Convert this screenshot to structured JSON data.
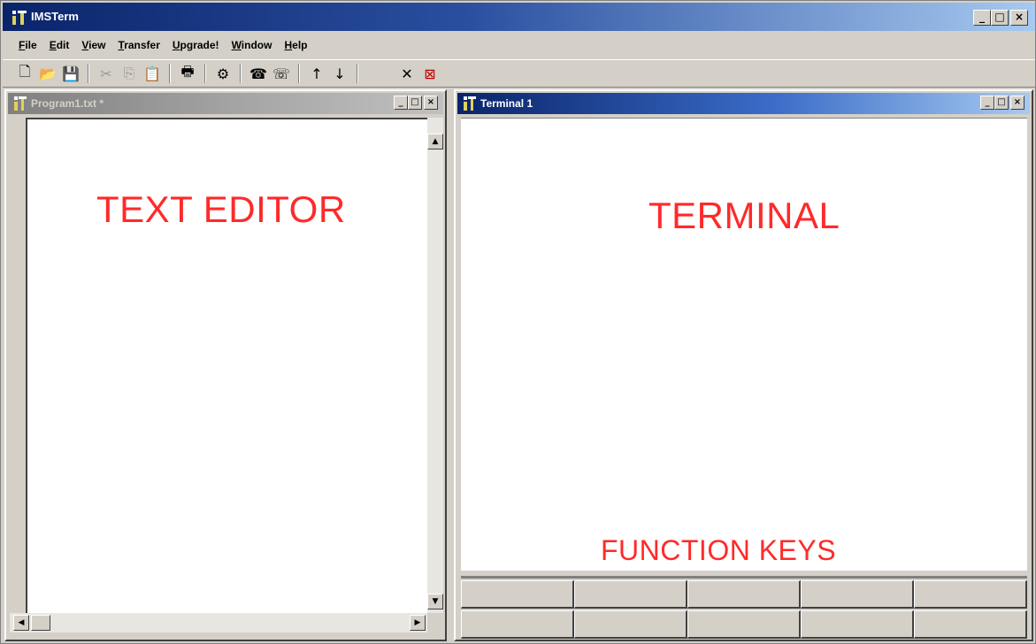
{
  "app": {
    "title": "IMSTerm",
    "window_buttons": [
      "_",
      "□",
      "×"
    ]
  },
  "menu": [
    {
      "accel": "F",
      "rest": "ile"
    },
    {
      "accel": "E",
      "rest": "dit"
    },
    {
      "accel": "V",
      "rest": "iew"
    },
    {
      "accel": "T",
      "rest": "ransfer"
    },
    {
      "accel": "U",
      "rest": "pgrade!"
    },
    {
      "accel": "W",
      "rest": "indow"
    },
    {
      "accel": "H",
      "rest": "elp"
    }
  ],
  "toolbar": {
    "icons": {
      "new": "new-file-icon",
      "open": "open-folder-icon",
      "save": "save-disk-icon",
      "cut": "cut-scissors-icon",
      "copy": "copy-icon",
      "paste": "paste-icon",
      "print": "print-icon",
      "settings": "settings-icon",
      "connect": "phone-connect-icon",
      "disconnect": "phone-disconnect-icon",
      "upload": "upload-arrow-icon",
      "download": "download-arrow-icon",
      "abort": "abort-x-icon",
      "stop": "stop-icon"
    },
    "glyphs": {
      "new": "🗋",
      "open": "📂",
      "save": "💾",
      "cut": "✂",
      "copy": "⎘",
      "paste": "📋",
      "print": "🖶",
      "settings": "⚙",
      "connect": "☎",
      "disconnect": "☏",
      "upload": "↑",
      "download": "↓",
      "abort": "✕",
      "stop": "⊠"
    }
  },
  "editor": {
    "title": "Program1.txt *",
    "overlay_label": "TEXT EDITOR",
    "scroll_glyphs": {
      "up": "▲",
      "down": "▼",
      "left": "◀",
      "right": "▶"
    }
  },
  "terminal": {
    "title": "Terminal 1",
    "overlay_label": "TERMINAL",
    "function_keys_label": "FUNCTION KEYS"
  },
  "colors": {
    "title_active": "#0a246a",
    "title_inactive": "#808080",
    "label_red": "#ff2a2a",
    "face": "#d4d0c8"
  }
}
